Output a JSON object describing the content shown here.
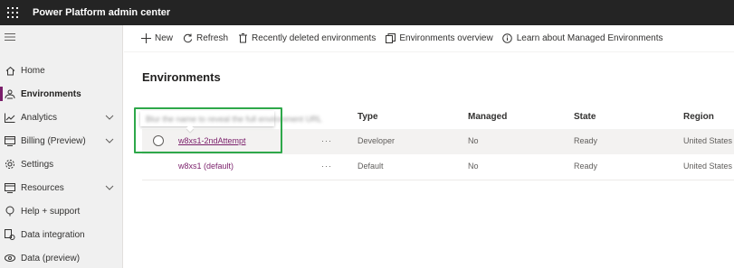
{
  "header": {
    "app_title": "Power Platform admin center",
    "waffle_icon": "waffle-icon"
  },
  "sidebar": {
    "menu_icon": "hamburger-icon",
    "items": [
      {
        "label": "Home",
        "icon": "home-icon",
        "expandable": false,
        "active": false
      },
      {
        "label": "Environments",
        "icon": "environments-icon",
        "expandable": false,
        "active": true
      },
      {
        "label": "Analytics",
        "icon": "analytics-icon",
        "expandable": true,
        "active": false
      },
      {
        "label": "Billing (Preview)",
        "icon": "billing-icon",
        "expandable": true,
        "active": false
      },
      {
        "label": "Settings",
        "icon": "gear-icon",
        "expandable": false,
        "active": false
      },
      {
        "label": "Resources",
        "icon": "resources-icon",
        "expandable": true,
        "active": false
      },
      {
        "label": "Help + support",
        "icon": "help-icon",
        "expandable": false,
        "active": false
      },
      {
        "label": "Data integration",
        "icon": "data-integration-icon",
        "expandable": false,
        "active": false
      },
      {
        "label": "Data (preview)",
        "icon": "data-preview-icon",
        "expandable": false,
        "active": false
      }
    ],
    "accent_color": "#7a1e6a"
  },
  "commandbar": {
    "new_label": "New",
    "refresh_label": "Refresh",
    "recently_deleted_label": "Recently deleted environments",
    "overview_label": "Environments overview",
    "learn_label": "Learn about Managed Environments"
  },
  "main": {
    "title": "Environments",
    "tooltip_text": "Blur the name to reveal the full environment URL",
    "columns": {
      "type": "Type",
      "managed": "Managed",
      "state": "State",
      "region": "Region"
    },
    "rows": [
      {
        "name": "w8xs1-2ndAttempt",
        "actions": "···",
        "type": "Developer",
        "managed": "No",
        "state": "Ready",
        "region": "United States"
      },
      {
        "name": "w8xs1 (default)",
        "actions": "···",
        "type": "Default",
        "managed": "No",
        "state": "Ready",
        "region": "United States"
      }
    ]
  },
  "colors": {
    "topbar": "#242424",
    "link": "#7a1e6a",
    "highlight": "#2ea84a",
    "selected_row": "#f3f2f1"
  }
}
